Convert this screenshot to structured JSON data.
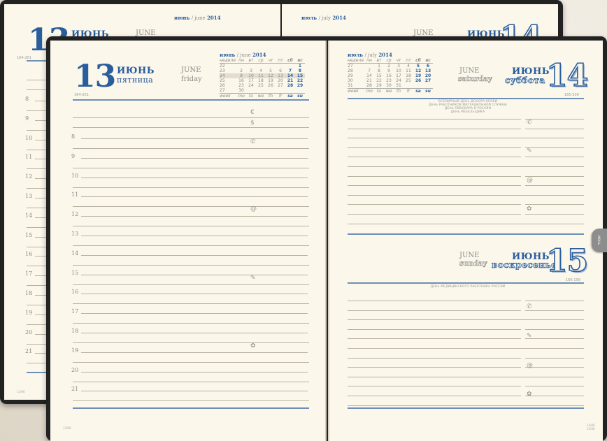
{
  "back_book": {
    "left_day": "13",
    "left_month_ru": "ИЮНЬ",
    "left_month_en": "JUNE",
    "left_code": "164-201",
    "cal_left": {
      "month_ru": "июнь",
      "month_en": "june",
      "year": "2014"
    },
    "cal_right": {
      "month_ru": "июль",
      "month_en": "july",
      "year": "2014"
    },
    "right_month_en": "JUNE",
    "right_month_ru": "ИЮНЬ",
    "right_day": "14",
    "hours": [
      "8",
      "9",
      "10",
      "11",
      "12",
      "13",
      "14",
      "15",
      "16",
      "17",
      "18",
      "19",
      "20",
      "21"
    ],
    "footer": "13/06"
  },
  "left_page": {
    "day_number": "13",
    "month_ru": "ИЮНЬ",
    "weekday_ru": "пятница",
    "month_en": "JUNE",
    "weekday_en": "friday",
    "day_code": "164-201",
    "hours": [
      "8",
      "9",
      "10",
      "11",
      "12",
      "13",
      "14",
      "15",
      "16",
      "17",
      "18",
      "19",
      "20",
      "21"
    ],
    "footer": "13/06",
    "calendar": {
      "month_ru": "июнь",
      "month_en": "june",
      "year": "2014",
      "header": [
        "неделя",
        "пн",
        "вт",
        "ср",
        "чт",
        "пт",
        "сб",
        "вс"
      ],
      "rows": [
        [
          "22",
          "",
          "",
          "",
          "",
          "",
          "",
          "1"
        ],
        [
          "23",
          "2",
          "3",
          "4",
          "5",
          "6",
          "7",
          "8"
        ],
        [
          "24",
          "9",
          "10",
          "11",
          "12",
          "13",
          "14",
          "15"
        ],
        [
          "25",
          "16",
          "17",
          "18",
          "19",
          "20",
          "21",
          "22"
        ],
        [
          "26",
          "23",
          "24",
          "25",
          "26",
          "27",
          "28",
          "29"
        ],
        [
          "27",
          "30",
          "",
          "",
          "",
          "",
          "",
          ""
        ]
      ],
      "footer": [
        "week",
        "mo",
        "tu",
        "we",
        "th",
        "fr",
        "sa",
        "su"
      ]
    }
  },
  "right_page": {
    "calendar": {
      "month_ru": "июль",
      "month_en": "july",
      "year": "2014",
      "header": [
        "неделя",
        "пн",
        "вт",
        "ср",
        "чт",
        "пт",
        "сб",
        "вс"
      ],
      "rows": [
        [
          "27",
          "",
          "1",
          "2",
          "3",
          "4",
          "5",
          "6"
        ],
        [
          "28",
          "7",
          "8",
          "9",
          "10",
          "11",
          "12",
          "13"
        ],
        [
          "29",
          "14",
          "15",
          "16",
          "17",
          "18",
          "19",
          "20"
        ],
        [
          "30",
          "21",
          "22",
          "23",
          "24",
          "25",
          "26",
          "27"
        ],
        [
          "31",
          "28",
          "29",
          "30",
          "31",
          "",
          "",
          ""
        ]
      ],
      "footer": [
        "week",
        "mo",
        "tu",
        "we",
        "th",
        "fr",
        "sa",
        "su"
      ]
    },
    "day14": {
      "month_en": "JUNE",
      "weekday_en": "saturday",
      "month_ru": "ИЮНЬ",
      "weekday_ru": "суббота",
      "day_number": "14",
      "day_code": "165-200",
      "holidays": [
        "ВСЕМИРНЫЙ ДЕНЬ ДОНОРА КРОВИ",
        "ДЕНЬ РАБОТНИКОВ МИГРАЦИОННОЙ СЛУЖБЫ",
        "ДЕНЬ ПИВОВАРА В РОССИИ",
        "ДЕНЬ МЕБЕЛЬЩИКА"
      ]
    },
    "day15": {
      "month_en": "JUNE",
      "weekday_en": "sunday",
      "month_ru": "ИЮНЬ",
      "weekday_ru": "воскресенье",
      "day_number": "15",
      "day_code": "166-199",
      "holidays": [
        "ДЕНЬ МЕДИЦИНСКОГО РАБОТНИКА РОССИИ"
      ]
    },
    "footer": [
      "14/06",
      "15/06"
    ],
    "tab_label": "ИЮНЬ"
  },
  "icons": {
    "euro": "€",
    "dollar": "$",
    "phone": "✆",
    "at": "@",
    "pen": "✎",
    "flower": "✿"
  },
  "colors": {
    "accent": "#2a5d9e",
    "paper": "#fbf7ea",
    "cover": "#222222"
  }
}
